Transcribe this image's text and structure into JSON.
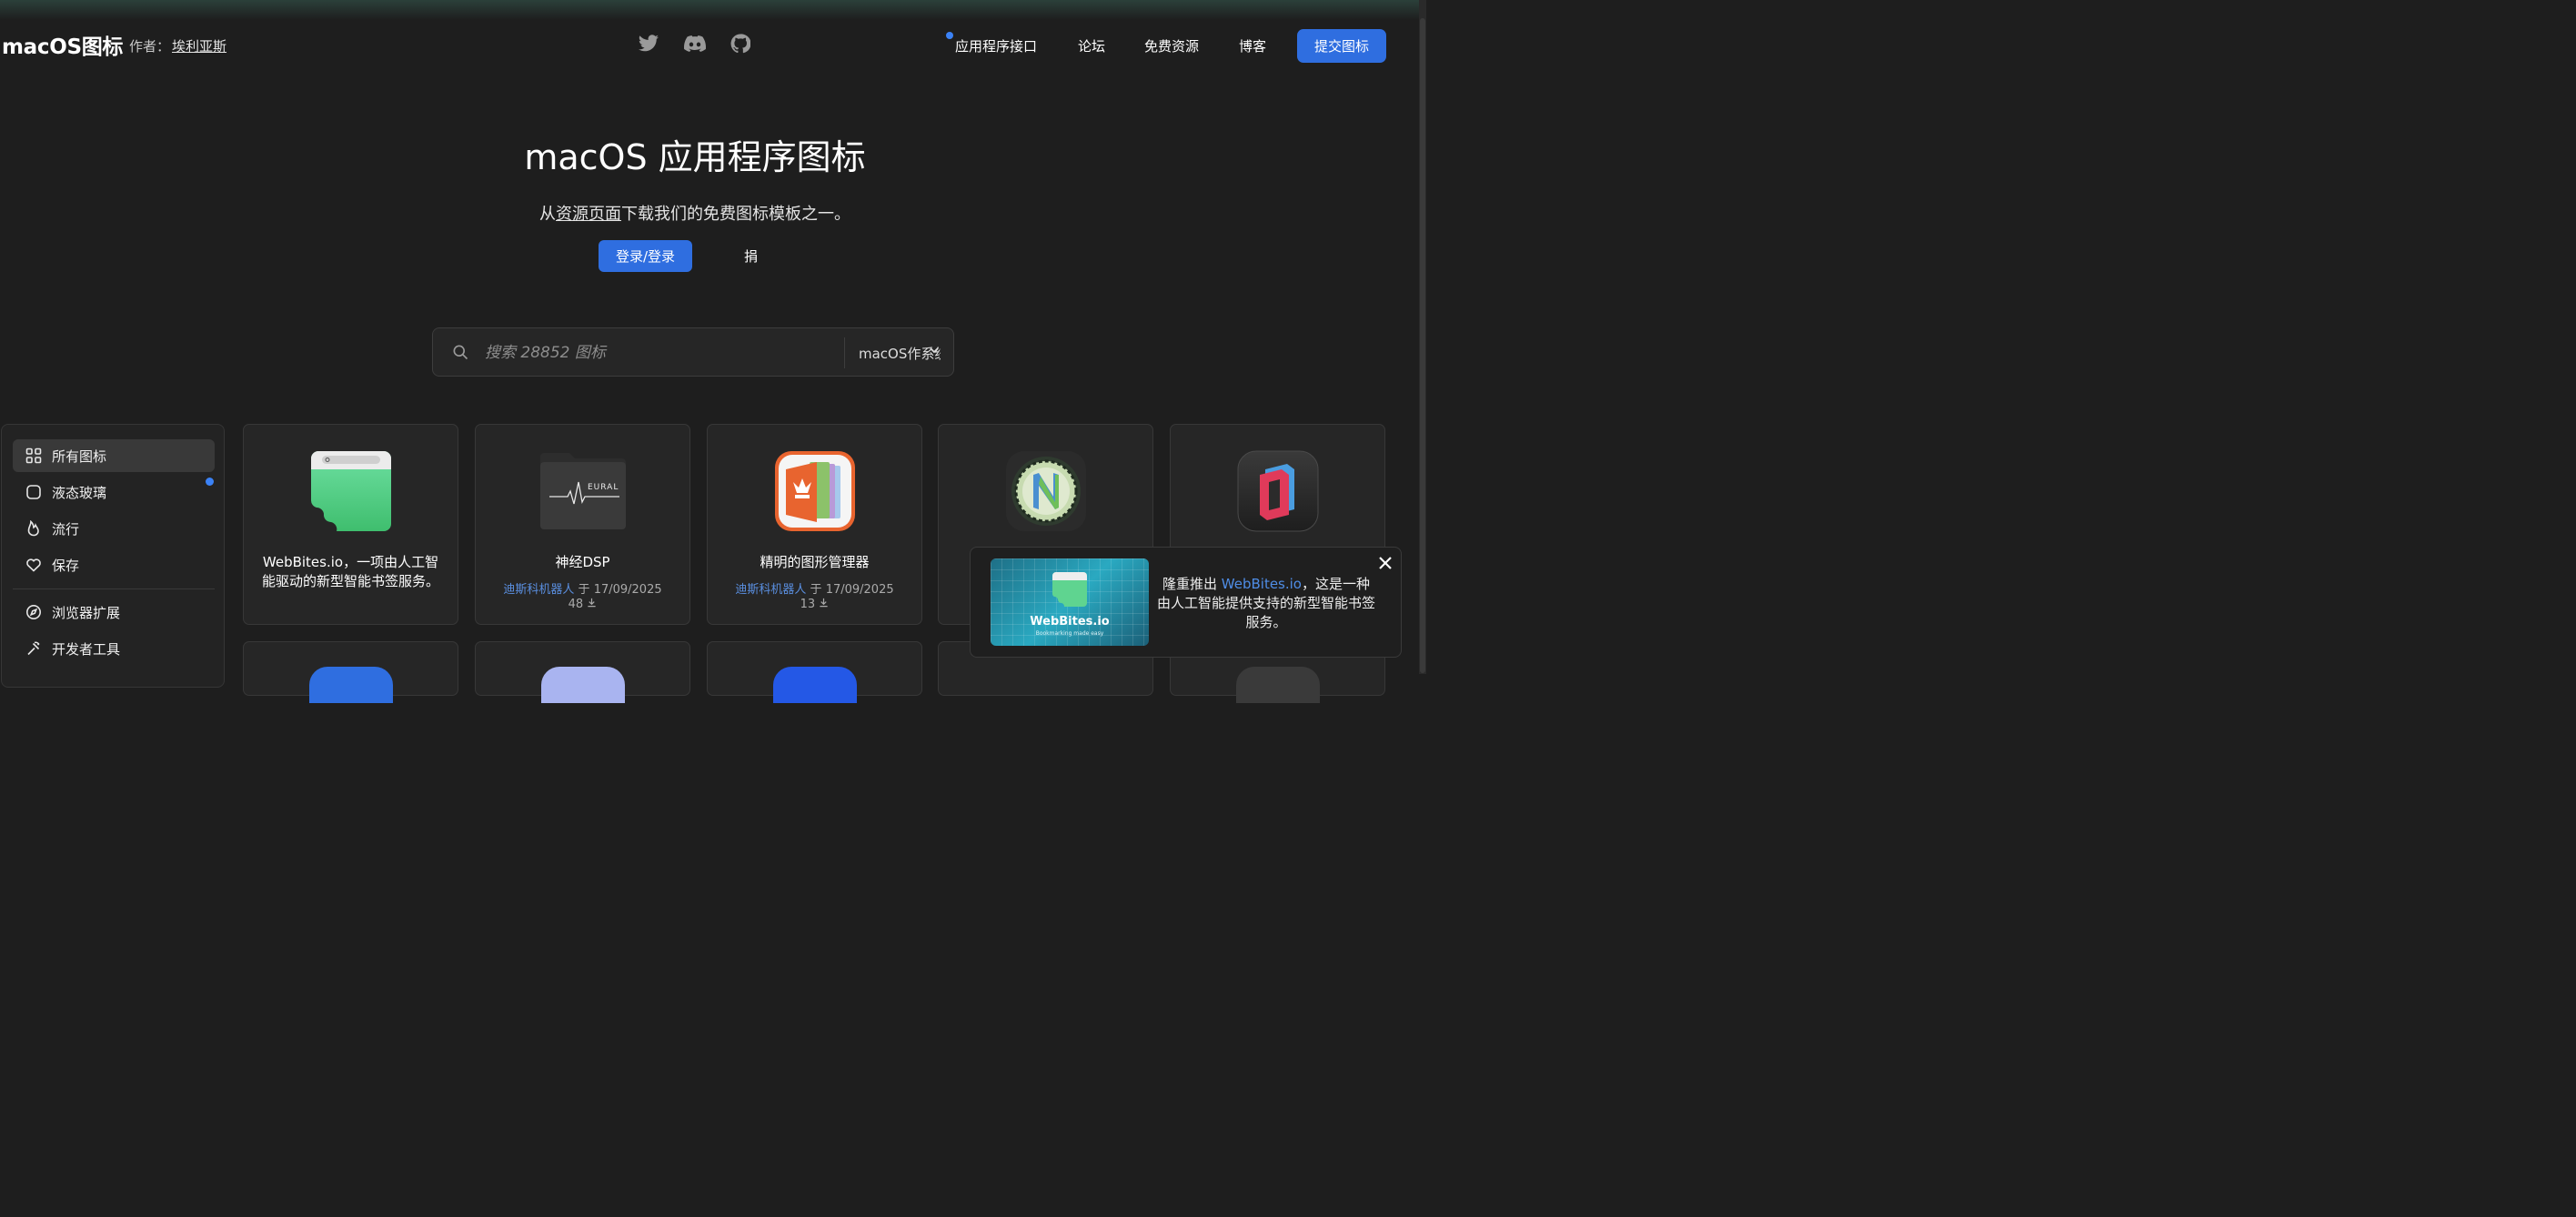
{
  "header": {
    "brand": "macOS图标",
    "by_label": "作者：",
    "author": "埃利亚斯",
    "social": [
      "twitter-icon",
      "discord-icon",
      "github-icon"
    ],
    "nav": [
      "应用程序接口",
      "论坛",
      "免费资源",
      "博客"
    ],
    "submit_label": "提交图标"
  },
  "hero": {
    "title": "macOS 应用程序图标",
    "sub_prefix": "从",
    "sub_link": "资源页面",
    "sub_suffix": "下载我们的免费图标模板之一。",
    "login_label": "登录/登录",
    "donate_label": "捐"
  },
  "search": {
    "placeholder": "搜索 28852 图标",
    "filter_value": "macOS作系统"
  },
  "sidebar": {
    "items": [
      {
        "label": "所有图标",
        "icon": "grid-icon"
      },
      {
        "label": "液态玻璃",
        "icon": "rounded-square-icon"
      },
      {
        "label": "流行",
        "icon": "flame-icon"
      },
      {
        "label": "保存",
        "icon": "heart-icon"
      },
      {
        "label": "浏览器扩展",
        "icon": "compass-icon"
      },
      {
        "label": "开发者工具",
        "icon": "hammer-icon"
      }
    ]
  },
  "cards": [
    {
      "title": "WebBites.io，一项由人工智能驱动的新型智能书签服务。",
      "author": "",
      "date": "",
      "downloads": ""
    },
    {
      "title": "神经DSP",
      "author": "迪斯科机器人",
      "date_prefix": "于",
      "date": "17/09/2025",
      "downloads": "48"
    },
    {
      "title": "精明的图形管理器",
      "author": "迪斯科机器人",
      "date_prefix": "于",
      "date": "17/09/2025",
      "downloads": "13"
    },
    {
      "title": "",
      "author": "",
      "date": "",
      "downloads": ""
    },
    {
      "title": "",
      "author": "",
      "date": "",
      "downloads": ""
    }
  ],
  "promo": {
    "thumb_name": "WebBites.io",
    "thumb_tag": "Bookmarking made easy",
    "text_prefix": "隆重推出 ",
    "text_link": "WebBites.io",
    "text_suffix": "，这是一种由人工智能提供支持的新型智能书签服务。"
  },
  "colors": {
    "background": "#1e1e1e",
    "accent": "#2f6ee0",
    "author_link": "#5a8fe0"
  }
}
